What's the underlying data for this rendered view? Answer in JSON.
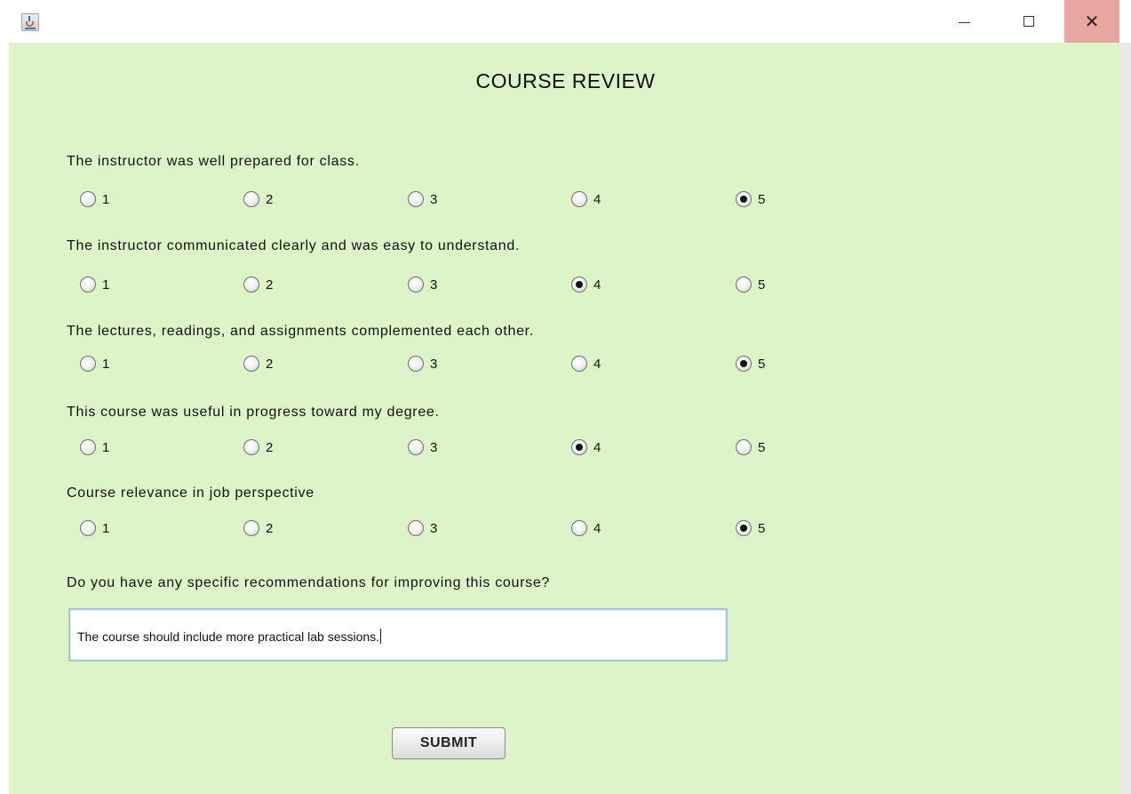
{
  "window": {
    "title": "",
    "controls": {
      "minimize": "minimize-icon",
      "maximize": "maximize-icon",
      "close": "close-icon"
    },
    "close_glyph": "✕",
    "close_hover_color": "#e8a6a0"
  },
  "form": {
    "heading": "COURSE REVIEW",
    "background_color": "#ddf4c9",
    "questions": [
      {
        "text": "The instructor was well prepared for class.",
        "options": [
          "1",
          "2",
          "3",
          "4",
          "5"
        ],
        "selected": "5"
      },
      {
        "text": "The instructor communicated clearly and was easy to understand.",
        "options": [
          "1",
          "2",
          "3",
          "4",
          "5"
        ],
        "selected": "4"
      },
      {
        "text": "The lectures, readings, and assignments complemented each other.",
        "options": [
          "1",
          "2",
          "3",
          "4",
          "5"
        ],
        "selected": "5"
      },
      {
        "text": "This course was useful in progress toward my degree.",
        "options": [
          "1",
          "2",
          "3",
          "4",
          "5"
        ],
        "selected": "4"
      },
      {
        "text": "Course relevance in job perspective",
        "options": [
          "1",
          "2",
          "3",
          "4",
          "5"
        ],
        "selected": "5"
      }
    ],
    "recommendation": {
      "question": "Do you have any specific recommendations for improving this course?",
      "value": "The course should include more practical lab sessions."
    },
    "submit_label": "SUBMIT"
  }
}
